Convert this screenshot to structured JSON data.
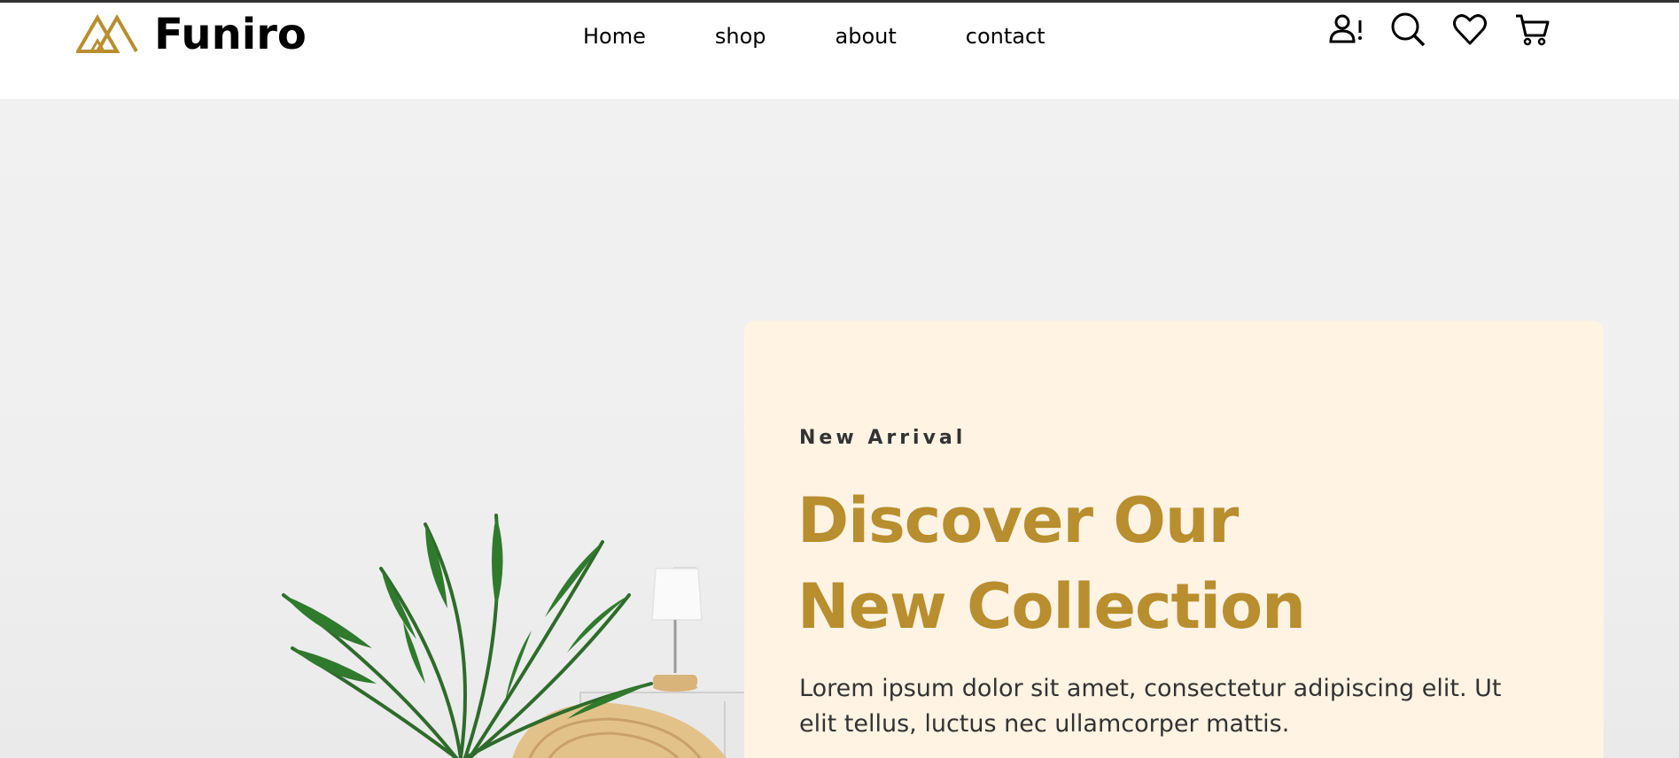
{
  "brand": {
    "name": "Funiro",
    "accent_color": "#b88e2f",
    "logo_icon": "funiro-logo-icon"
  },
  "nav": {
    "items": [
      {
        "label": "Home"
      },
      {
        "label": "shop"
      },
      {
        "label": "about"
      },
      {
        "label": "contact"
      }
    ]
  },
  "header_icons": [
    "user-alert-icon",
    "search-icon",
    "heart-icon",
    "cart-icon"
  ],
  "hero": {
    "subtitle": "New Arrival",
    "heading_line1": "Discover Our",
    "heading_line2": "New Collection",
    "description": "Lorem ipsum dolor sit amet, consectetur adipiscing elit. Ut elit tellus, luctus nec ullamcorper mattis.",
    "card_color": "#fff3e3"
  }
}
